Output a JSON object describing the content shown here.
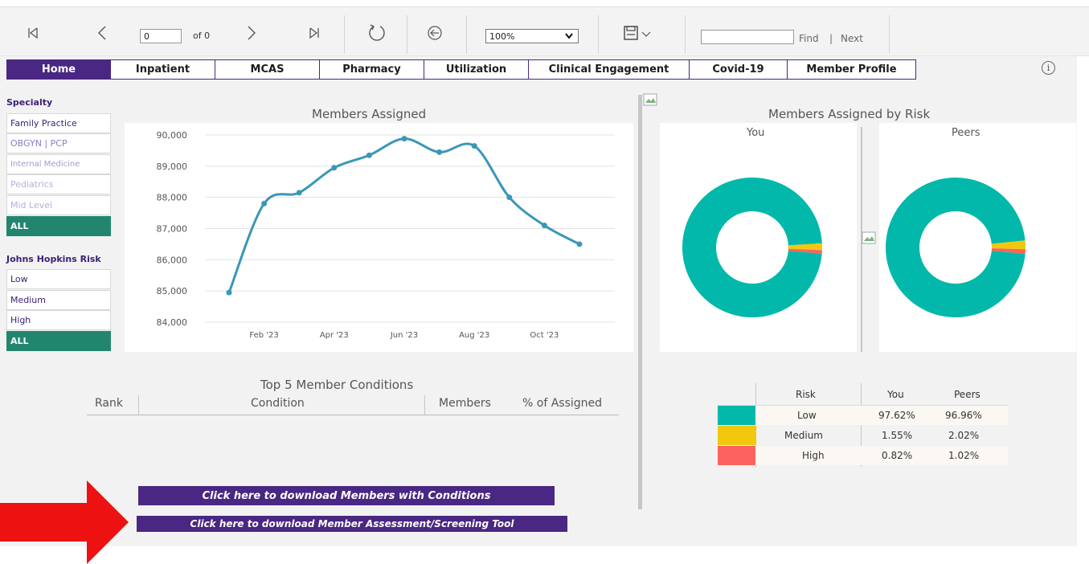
{
  "toolbar": {
    "first_icon": "first-page-icon",
    "prev_icon": "previous-page-icon",
    "page_value": "0",
    "of_label": "of 0",
    "next_icon": "next-page-icon",
    "last_icon": "last-page-icon",
    "refresh_icon": "refresh-icon",
    "back_icon": "back-circle-icon",
    "zoom_value": "100%",
    "save_icon": "save-icon",
    "find_value": "",
    "find_label": "Find",
    "sep_label": "|",
    "next_label": "Next"
  },
  "tabs": [
    {
      "label": "Home",
      "active": true
    },
    {
      "label": "Inpatient"
    },
    {
      "label": "MCAS"
    },
    {
      "label": "Pharmacy"
    },
    {
      "label": "Utilization"
    },
    {
      "label": "Clinical Engagement"
    },
    {
      "label": "Covid-19"
    },
    {
      "label": "Member Profile"
    }
  ],
  "info_icon": "info-icon",
  "specialty": {
    "title": "Specialty",
    "items": [
      "Family Practice",
      "OBGYN | PCP",
      "Internal Medicine",
      "Pediatrics",
      "Mid Level",
      "ALL"
    ]
  },
  "risk_filter": {
    "title": "Johns Hopkins Risk",
    "items": [
      "Low",
      "Medium",
      "High",
      "ALL"
    ]
  },
  "members_chart": {
    "title": "Members Assigned",
    "y_ticks": [
      "90,000",
      "89,000",
      "88,000",
      "87,000",
      "86,000",
      "85,000",
      "84,000"
    ],
    "x_ticks": [
      "Feb '23",
      "Apr '23",
      "Jun '23",
      "Aug '23",
      "Oct '23"
    ]
  },
  "risk_chart": {
    "title": "Members Assigned by Risk",
    "you_label": "You",
    "peers_label": "Peers"
  },
  "conditions": {
    "title": "Top 5 Member Conditions",
    "columns": [
      "Rank",
      "Condition",
      "Members",
      "% of Assigned"
    ]
  },
  "risk_table": {
    "headers": [
      "Risk",
      "You",
      "Peers"
    ],
    "rows": [
      {
        "risk": "Low",
        "you": "97.62%",
        "peers": "96.96%",
        "color": "#01b8aa"
      },
      {
        "risk": "Medium",
        "you": "1.55%",
        "peers": "2.02%",
        "color": "#f2c80f"
      },
      {
        "risk": "High",
        "you": "0.82%",
        "peers": "1.02%",
        "color": "#fd625e"
      }
    ]
  },
  "downloads": {
    "conditions_label": "Click here to download Members with Conditions",
    "assessment_label": "Click here to download Member Assessment/Screening Tool"
  },
  "annotation": {
    "arrow_color": "#ee1111"
  },
  "colors": {
    "purple": "#4a2782",
    "green": "#22866e",
    "line": "#3a97b8"
  },
  "chart_data": [
    {
      "type": "line",
      "title": "Members Assigned",
      "x": [
        "Jan '23",
        "Feb '23",
        "Mar '23",
        "Apr '23",
        "May '23",
        "Jun '23",
        "Jul '23",
        "Aug '23",
        "Sep '23",
        "Oct '23",
        "Nov '23"
      ],
      "y": [
        84950,
        87800,
        88150,
        88950,
        89350,
        89880,
        89450,
        89650,
        88000,
        87100,
        86500
      ],
      "ylim": [
        84000,
        90000
      ],
      "y_ticks": [
        84000,
        85000,
        86000,
        87000,
        88000,
        89000,
        90000
      ],
      "x_tick_labels": [
        "Feb '23",
        "Apr '23",
        "Jun '23",
        "Aug '23",
        "Oct '23"
      ],
      "grid": true
    },
    {
      "type": "pie",
      "title": "You",
      "categories": [
        "Low",
        "Medium",
        "High"
      ],
      "values": [
        97.62,
        1.55,
        0.82
      ]
    },
    {
      "type": "pie",
      "title": "Peers",
      "categories": [
        "Low",
        "Medium",
        "High"
      ],
      "values": [
        96.96,
        2.02,
        1.02
      ]
    }
  ]
}
